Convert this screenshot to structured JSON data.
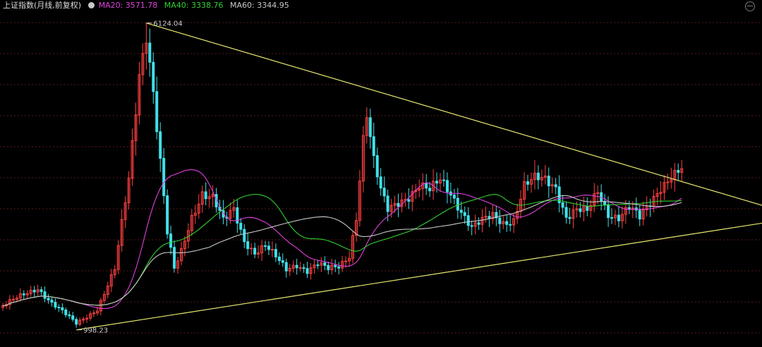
{
  "header": {
    "title": "上证指数(月线,前复权)",
    "ma20": {
      "label": "MA20: 3571.78",
      "color": "#e040e0"
    },
    "ma40": {
      "label": "MA40: 3338.76",
      "color": "#30d030"
    },
    "ma60": {
      "label": "MA60: 3344.95",
      "color": "#c8c8c8"
    }
  },
  "chart_data": {
    "type": "candlestick",
    "title": "上证指数(月线,前复权)",
    "colors": {
      "up": "#ff4040",
      "down": "#40e0e8",
      "ma20": "#e040e0",
      "ma40": "#30d030",
      "ma60": "#c8c8c8",
      "trend": "#e8e870",
      "grid": "#5a1a1a"
    },
    "y_range": [
      900,
      6250
    ],
    "annotations": [
      {
        "label": "6124.04",
        "value": 6124.04,
        "index": 41,
        "position": "high"
      },
      {
        "label": "998.23",
        "value": 998.23,
        "index": 21,
        "position": "low"
      }
    ],
    "trendlines": [
      {
        "name": "upper",
        "from": {
          "index": 41,
          "value": 6124.04
        },
        "to": {
          "index": 218,
          "value": 3060
        }
      },
      {
        "name": "lower",
        "from": {
          "index": 21,
          "value": 998.23
        },
        "to": {
          "index": 218,
          "value": 2790
        }
      }
    ],
    "anchors": [
      [
        0,
        1400
      ],
      [
        10,
        1700
      ],
      [
        14,
        1450
      ],
      [
        21,
        1100
      ],
      [
        27,
        1350
      ],
      [
        32,
        2000
      ],
      [
        36,
        3500
      ],
      [
        39,
        5300
      ],
      [
        41,
        6000
      ],
      [
        43,
        5000
      ],
      [
        45,
        3800
      ],
      [
        47,
        2600
      ],
      [
        49,
        2000
      ],
      [
        51,
        2300
      ],
      [
        54,
        2900
      ],
      [
        57,
        3300
      ],
      [
        60,
        3200
      ],
      [
        63,
        2800
      ],
      [
        66,
        3000
      ],
      [
        69,
        2500
      ],
      [
        72,
        2300
      ],
      [
        75,
        2400
      ],
      [
        78,
        2200
      ],
      [
        81,
        2000
      ],
      [
        84,
        2100
      ],
      [
        87,
        2000
      ],
      [
        90,
        2100
      ],
      [
        93,
        2000
      ],
      [
        96,
        2050
      ],
      [
        99,
        2250
      ],
      [
        101,
        2900
      ],
      [
        103,
        4200
      ],
      [
        104,
        4600
      ],
      [
        106,
        3800
      ],
      [
        108,
        3300
      ],
      [
        110,
        3000
      ],
      [
        113,
        3150
      ],
      [
        116,
        3250
      ],
      [
        119,
        3400
      ],
      [
        122,
        3300
      ],
      [
        125,
        3500
      ],
      [
        128,
        3300
      ],
      [
        131,
        3000
      ],
      [
        134,
        2700
      ],
      [
        137,
        2800
      ],
      [
        140,
        2900
      ],
      [
        143,
        2800
      ],
      [
        146,
        2850
      ],
      [
        149,
        3400
      ],
      [
        152,
        3500
      ],
      [
        155,
        3500
      ],
      [
        158,
        3400
      ],
      [
        161,
        2900
      ],
      [
        164,
        3000
      ],
      [
        167,
        2950
      ],
      [
        170,
        3300
      ],
      [
        173,
        2950
      ],
      [
        176,
        2900
      ],
      [
        179,
        3050
      ],
      [
        182,
        2850
      ],
      [
        185,
        3100
      ],
      [
        188,
        3400
      ],
      [
        191,
        3600
      ],
      [
        193,
        3650
      ],
      [
        194,
        3700
      ]
    ]
  }
}
